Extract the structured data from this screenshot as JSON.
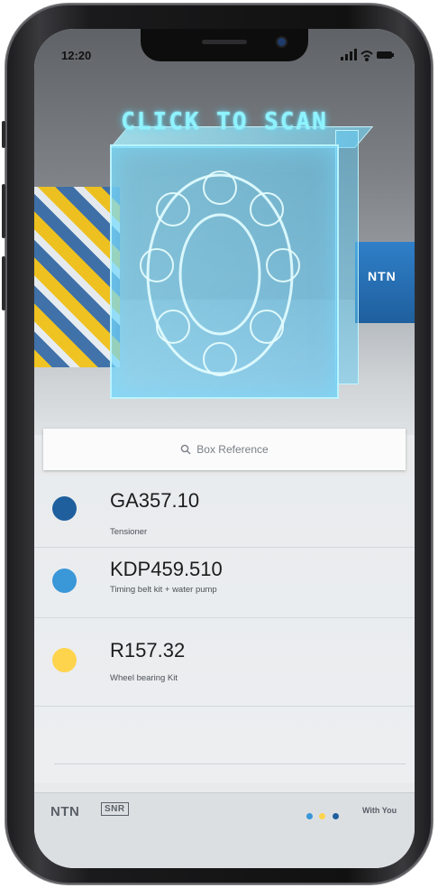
{
  "status_bar": {
    "time": "12:20"
  },
  "hero": {
    "scan_label": "CLICK TO SCAN",
    "box_label": "NTN"
  },
  "search": {
    "placeholder": "Box Reference",
    "icon": "search-icon"
  },
  "items": [
    {
      "code": "GA357.10",
      "description": "Tensioner",
      "color": "#1f5f9e"
    },
    {
      "code": "KDP459.510",
      "description": "Timing belt kit + water pump",
      "color": "#3a97d8"
    },
    {
      "code": "R157.32",
      "description": "Wheel bearing Kit",
      "color": "#ffd44d"
    }
  ],
  "footer": {
    "brand": "NTN",
    "sub_brand": "SNR",
    "tagline": "With You",
    "dot_colors": [
      "#3a97d8",
      "#ffd44d",
      "#1f5f9e"
    ]
  }
}
